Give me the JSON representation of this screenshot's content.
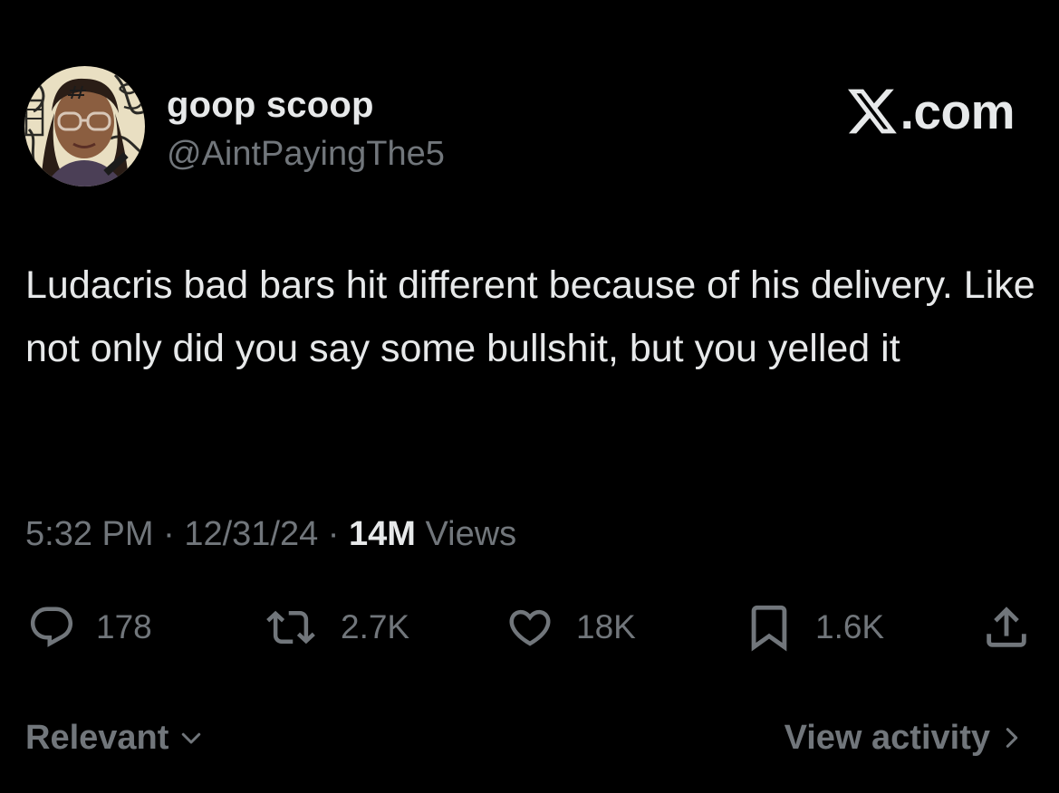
{
  "author": {
    "display_name": "goop scoop",
    "handle": "@AintPayingThe5",
    "avatar_icon": "profile-photo"
  },
  "brand": {
    "icon": "x-logo-icon",
    "text": ".com"
  },
  "tweet": {
    "text": "Ludacris bad bars hit different because of his delivery. Like not only did you say some bullshit, but you yelled it",
    "time": "5:32 PM",
    "separator": " · ",
    "date": "12/31/24",
    "views_count": "14M",
    "views_label": " Views"
  },
  "actions": {
    "reply": {
      "icon": "reply-icon",
      "count": "178"
    },
    "repost": {
      "icon": "repost-icon",
      "count": "2.7K"
    },
    "like": {
      "icon": "heart-icon",
      "count": "18K"
    },
    "bookmark": {
      "icon": "bookmark-icon",
      "count": "1.6K"
    },
    "share": {
      "icon": "share-icon"
    }
  },
  "footer": {
    "sort_label": "Relevant",
    "activity_label": "View activity"
  },
  "colors": {
    "background": "#000000",
    "text_primary": "#e7e9ea",
    "text_secondary": "#71767b"
  }
}
